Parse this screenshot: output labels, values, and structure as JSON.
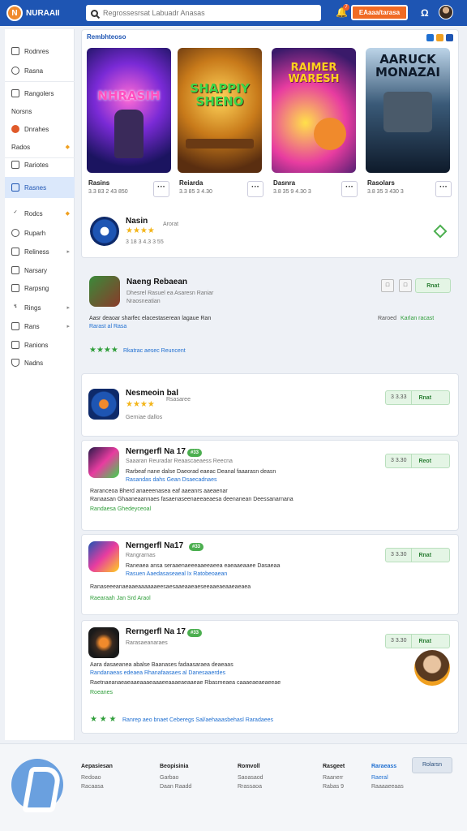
{
  "header": {
    "brand": "NURAAII",
    "search_placeholder": "Regrossesrsat Labuadr Anasas",
    "notification_count": "7",
    "cta_label": "EAaaa/tarasa"
  },
  "sidebar": {
    "items": [
      {
        "label": "Rodnres",
        "icon": "home-icon"
      },
      {
        "label": "Rasna",
        "icon": "clock-icon"
      },
      {
        "label": "Rangolers",
        "icon": "tag-icon"
      },
      {
        "label": "Norsns",
        "icon": ""
      },
      {
        "label": "Dnrahes",
        "icon": "fire-icon"
      },
      {
        "label": "Rados",
        "icon": "",
        "badge": "◆"
      },
      {
        "label": "Rariotes",
        "icon": "grid-icon"
      },
      {
        "label": "Rasnes",
        "icon": "document-icon"
      },
      {
        "label": "Rodcs",
        "icon": "check-icon",
        "badge": "◆"
      },
      {
        "label": "Ruparh",
        "icon": "gear-icon"
      },
      {
        "label": "Reliness",
        "icon": "chart-icon",
        "arrow": "▸"
      },
      {
        "label": "Narsary",
        "icon": "list-icon"
      },
      {
        "label": "Rarpsng",
        "icon": "table-icon"
      },
      {
        "label": "Rings",
        "icon": "link-icon",
        "arrow": "▸"
      },
      {
        "label": "Rans",
        "icon": "folder-icon",
        "arrow": "▸"
      },
      {
        "label": "Ranions",
        "icon": "bookmark-icon"
      },
      {
        "label": "Nadns",
        "icon": "shield-icon"
      }
    ]
  },
  "featured": {
    "title": "Rembhteoso",
    "tiles": [
      {
        "art": "NHRASIH",
        "name": "Rasins",
        "meta": "3.3 83 2 43 850"
      },
      {
        "art": "SHAPPIY SHENO",
        "name": "Reiarda",
        "meta": "3.3 85 3 4.30"
      },
      {
        "art": "RAIMER WARESH",
        "name": "Dasnra",
        "meta": "3.8 35 9 4.30 3"
      },
      {
        "art": "AARUCK MONAZAI",
        "name": "Rasolars",
        "meta": "3.8 35 3 430 3"
      }
    ],
    "promo": {
      "title": "Nasin",
      "sub": "Arorat",
      "meta": "3 18 3 4.3 3 55"
    }
  },
  "apps": [
    {
      "title": "Naeng Rebaean",
      "sub": "Dhesrel  Rasuel ea Asaresn Raniar",
      "sub2": "Nraosneatian",
      "desc1": "Aasr deaoar sharfec elacestaserean lagaue Ran",
      "desc2": "Rarast al  Rasa",
      "rating_text": "Rkatrac aesec Reuncent",
      "side_label": "Raroed",
      "side_link": "Karlan racast",
      "btn": "Rnat"
    },
    {
      "title": "Nesmeoin bal",
      "sub": "Rsasaree",
      "meta": "Gerniae dallos",
      "price": "3 3.33",
      "btn": "Rnat"
    },
    {
      "title": "Nerngerfl Na 17",
      "rank": "#33",
      "sub": "Saaaran Reuradar Reaascaeaess Reecna",
      "desc1": "Rarbeaf nane dalse Daeorad eaeac Deanal faaarasn deasn",
      "desc2": "Rasandas dahs Gean Dsaecadnaes",
      "desc3": "Raranceoa Bherd anaeeenasea eaf aaeanrs aaeaenar",
      "desc4": "Ranaasan Ghaaneaannaes fasaenaseenaeeaeaesa deenanean Deessanarnana",
      "desc5": "Randaesa Ghedeyceoal",
      "price": "3 3.30",
      "btn": "Reot"
    },
    {
      "title": "Nerngerfl Na17",
      "rank": "#33",
      "sub": "Rangrarnas",
      "desc1": "Raneaea ansa seraaenaeeeaaeeaeea eaeaaeaaee Dasaeaa",
      "desc2": "Rasuen  Aaedasaseaeal Ix Ratobeoaean",
      "desc3": "Ranaseeeanaeaaeaaaaaaeesaesaaeaaeaeseeaaeaeaaeaeaea",
      "desc4": "Raearaah  Jan  Srd Araol",
      "price": "3 3.30",
      "btn": "Rnat"
    },
    {
      "title": "Rerngerfl Na 17",
      "rank": "#33",
      "sub": "Rarasaeanaraes",
      "desc1": "Aara dasaeanea abalse Baanases fadaasaraea deaeaas",
      "desc2": "Randanaeas edeaea  Rhanafaasaes al Danesaaerdes",
      "desc3": "Raetnaeanaeaeaaeaaaeaaaeeaaaeaeaaeae Rbasmeaea caaaeaeaeaeeae",
      "desc4": "Roeanes",
      "rating_text": "Ranrep aeo bnaet Ceberegs  Sal/aehaaasbehasl Raradaees",
      "price": "3 3.30",
      "btn": "Rnat"
    }
  ],
  "footer": {
    "columns": [
      {
        "title": "Aepasiesan",
        "items": [
          "Redoao",
          "Racaasa"
        ]
      },
      {
        "title": "Beopisinia",
        "items": [
          "Garbao",
          "Daan Raadd"
        ]
      },
      {
        "title": "Romvoll",
        "items": [
          "Saoasaod",
          "Rrassaoa"
        ]
      },
      {
        "title": "Rasgeet",
        "items": [
          "Raanerr",
          "Rabas 9"
        ]
      },
      {
        "title": "Raraeass",
        "items": [
          "Raeral",
          "Raaaaeeaas"
        ]
      }
    ],
    "button": "Rolarsn"
  }
}
